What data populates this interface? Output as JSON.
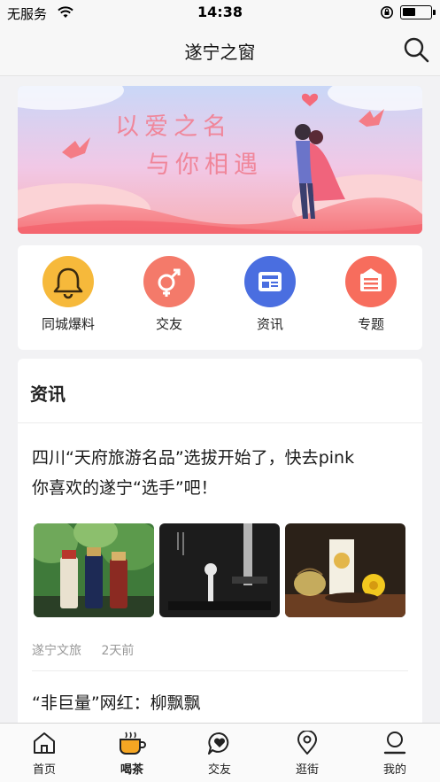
{
  "status_bar": {
    "carrier": "无服务",
    "time": "14:38"
  },
  "header": {
    "title": "遂宁之窗",
    "search_icon": "search-icon"
  },
  "banner": {
    "line1": "以爱之名",
    "line2": "与你相遇"
  },
  "quick_menu": [
    {
      "label": "同城爆料",
      "icon": "bell-icon",
      "color": "#f6b93b"
    },
    {
      "label": "交友",
      "icon": "gender-icon",
      "color": "#f47a6a"
    },
    {
      "label": "资讯",
      "icon": "news-icon",
      "color": "#4a6ee0"
    },
    {
      "label": "专题",
      "icon": "topic-icon",
      "color": "#f76d5d"
    }
  ],
  "news": {
    "section_title": "资讯",
    "articles": [
      {
        "title_line1": "四川“天府旅游名品”选拔开始了，快去pink",
        "title_line2": "你喜欢的遂宁“选手”吧！",
        "source": "遂宁文旅",
        "time": "2天前"
      },
      {
        "title": "“非巨量”网红：柳飘飘"
      }
    ]
  },
  "tab_bar": [
    {
      "label": "首页",
      "icon": "home-icon"
    },
    {
      "label": "喝茶",
      "icon": "tea-cup-icon",
      "active": true
    },
    {
      "label": "交友",
      "icon": "chat-heart-icon"
    },
    {
      "label": "逛街",
      "icon": "location-pin-icon"
    },
    {
      "label": "我的",
      "icon": "user-icon"
    }
  ]
}
